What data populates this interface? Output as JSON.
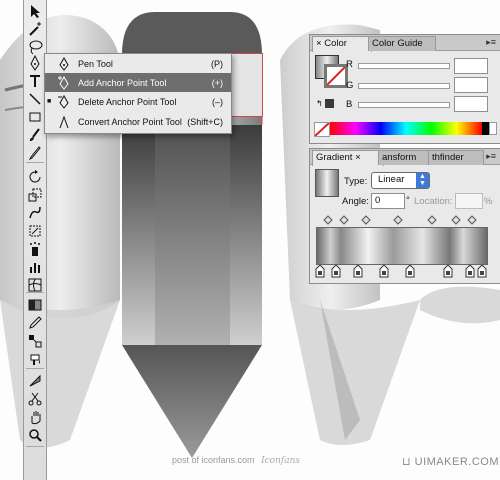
{
  "tools_panel": {
    "tools": [
      "selection-tool",
      "magic-wand-tool",
      "lasso-tool",
      "pen-tool",
      "type-tool",
      "line-tool",
      "rectangle-tool",
      "paintbrush-tool",
      "pencil-tool",
      "rotate-tool",
      "scale-tool",
      "warp-tool",
      "free-transform-tool",
      "symbol-sprayer-tool",
      "graph-tool",
      "mesh-tool",
      "gradient-tool",
      "eyedropper-tool",
      "blend-tool",
      "live-paint-tool",
      "slice-tool",
      "scissors-tool",
      "hand-tool",
      "zoom-tool"
    ]
  },
  "pen_flyout": {
    "items": [
      {
        "label": "Pen Tool",
        "shortcut": "(P)",
        "selected": false,
        "current": false
      },
      {
        "label": "Add Anchor Point Tool",
        "shortcut": "(+)",
        "selected": true,
        "current": false
      },
      {
        "label": "Delete Anchor Point Tool",
        "shortcut": "(–)",
        "selected": false,
        "current": true
      },
      {
        "label": "Convert Anchor Point Tool",
        "shortcut": "(Shift+C)",
        "selected": false,
        "current": false
      }
    ]
  },
  "color_panel": {
    "tabs": [
      "Color",
      "Color Guide"
    ],
    "close_glyph": "×",
    "channels": [
      "R",
      "G",
      "B"
    ]
  },
  "gradient_panel": {
    "tabs": [
      "Gradient",
      "ansform",
      "thfinder"
    ],
    "close_glyph": "×",
    "type_label": "Type:",
    "type_value": "Linear",
    "angle_label": "Angle:",
    "angle_value": "0",
    "degree_symbol": "°",
    "location_label": "Location:",
    "percent_symbol": "%"
  },
  "watermark": {
    "posted_by": "post of iconfans.com",
    "logo_text": "Iconfans",
    "site": "UIMAKER.COM"
  },
  "colors": {
    "pencil_dark": "#3a3a3a",
    "pencil_light": "#d5d5d5",
    "selection_red": "#c84a4a",
    "flyout_highlight": "#6e6e6e"
  }
}
